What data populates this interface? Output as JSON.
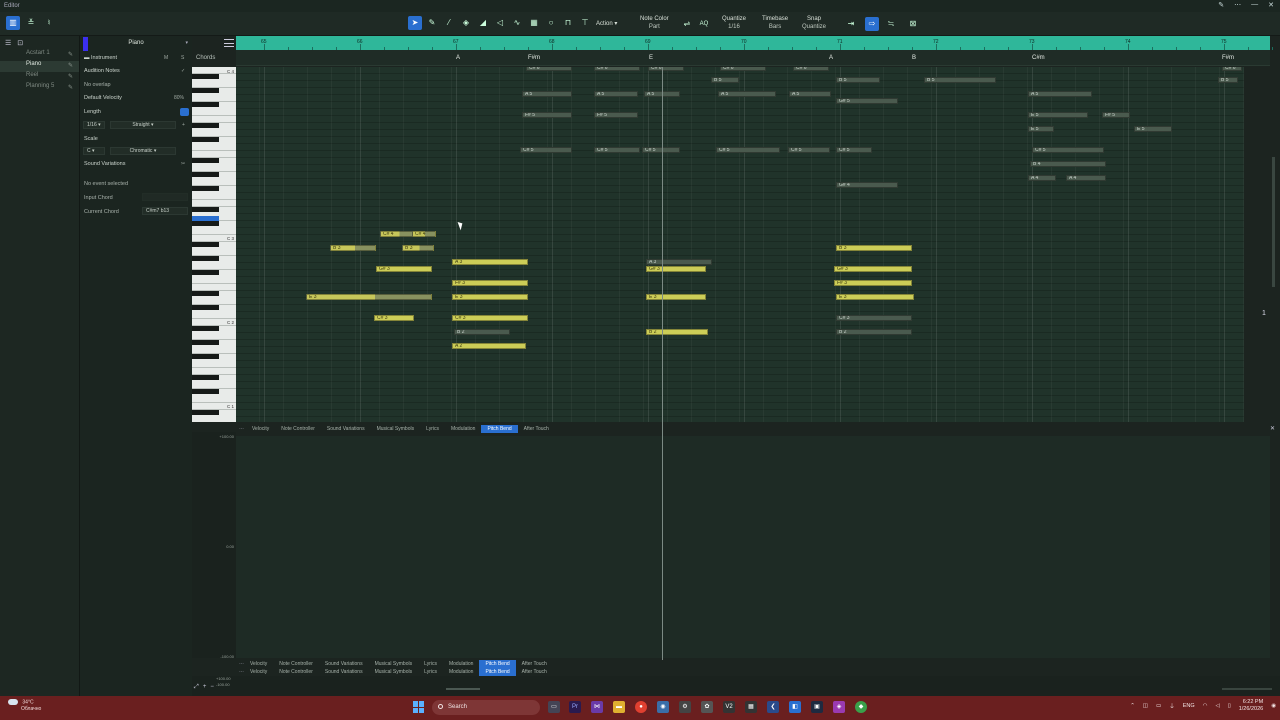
{
  "window": {
    "title": "Editor",
    "controls": [
      "✎",
      "⋯",
      "—",
      "✕"
    ]
  },
  "toolbar": {
    "action_label": "Action",
    "note_color": {
      "title": "Note Color",
      "value": "Part"
    },
    "quantize": {
      "title": "Quantize",
      "value": "1/16"
    },
    "timebase": {
      "title": "Timebase",
      "value": "Bars"
    },
    "snap": {
      "title": "Snap",
      "value": "Quantize"
    }
  },
  "tracks": [
    {
      "label": "Acstart 1",
      "selected": false
    },
    {
      "label": "Piano",
      "selected": true
    },
    {
      "label": "Reel",
      "selected": false
    },
    {
      "label": "Planning 5",
      "selected": false
    }
  ],
  "inspector": {
    "part_name": "Piano",
    "instrument_label": "Instrument",
    "m_label": "M",
    "s_label": "S",
    "audition_notes": "Audition Notes",
    "no_overlap": "No overlap",
    "default_velocity": "Default Velocity",
    "default_velocity_value": "80%",
    "length_label": "Length",
    "length_value": "1/16",
    "length_mode": "Straight",
    "scale_label": "Scale",
    "scale_root": "C",
    "scale_type": "Chromatic",
    "sound_variations": "Sound Variations",
    "no_event": "No event selected",
    "input_chord": "Input Chord",
    "current_chord": "Current Chord",
    "current_chord_value": "C#m7 b13",
    "chords_label": "Chords"
  },
  "ruler": {
    "bars": [
      "65",
      "66",
      "67",
      "68",
      "69",
      "70",
      "71",
      "72",
      "73",
      "74",
      "75"
    ]
  },
  "chord_track": [
    "A",
    "F#m",
    "E",
    "A",
    "B",
    "C#m",
    "F#m"
  ],
  "piano_labels": [
    "C 4",
    "C 3",
    "C 2",
    "C 1"
  ],
  "notes": [
    {
      "label": "C# 6",
      "style": "lo"
    },
    {
      "label": "C# 6",
      "style": "lo"
    },
    {
      "label": "C# 6",
      "style": "lo"
    },
    {
      "label": "C# 6",
      "style": "lo"
    },
    {
      "label": "C# 6",
      "style": "lo"
    },
    {
      "label": "C# 6",
      "style": "lo"
    },
    {
      "label": "B 5",
      "style": "lo"
    },
    {
      "label": "B 5",
      "style": "lo"
    },
    {
      "label": "B 5",
      "style": "lo"
    },
    {
      "label": "B 5",
      "style": "lo"
    },
    {
      "label": "A 5",
      "style": "lo"
    },
    {
      "label": "A 5",
      "style": "lo"
    },
    {
      "label": "A 5",
      "style": "lo"
    },
    {
      "label": "A 5",
      "style": "lo"
    },
    {
      "label": "A 5",
      "style": "lo"
    },
    {
      "label": "A 5",
      "style": "lo"
    },
    {
      "label": "G# 5",
      "style": "lo"
    },
    {
      "label": "F# 5",
      "style": "lo"
    },
    {
      "label": "F# 5",
      "style": "lo"
    },
    {
      "label": "F# 5",
      "style": "lo"
    },
    {
      "label": "E 5",
      "style": "lo"
    },
    {
      "label": "E 5",
      "style": "lo"
    },
    {
      "label": "E 5",
      "style": "lo"
    },
    {
      "label": "C# 5",
      "style": "lo"
    },
    {
      "label": "C# 5",
      "style": "lo"
    },
    {
      "label": "C# 5",
      "style": "lo"
    },
    {
      "label": "C# 5",
      "style": "lo"
    },
    {
      "label": "C# 5",
      "style": "lo"
    },
    {
      "label": "C# 5",
      "style": "lo"
    },
    {
      "label": "C# 5",
      "style": "lo"
    },
    {
      "label": "B 4",
      "style": "lo"
    },
    {
      "label": "A 4",
      "style": "lo"
    },
    {
      "label": "A 4",
      "style": "lo"
    },
    {
      "label": "G# 4",
      "style": "lo"
    },
    {
      "label": "C# 4",
      "style": "mid"
    },
    {
      "label": "C# 4",
      "style": "mid"
    },
    {
      "label": "B 3",
      "style": "mid"
    },
    {
      "label": "B 3",
      "style": "mid"
    },
    {
      "label": "B 3",
      "style": "hi"
    },
    {
      "label": "G# 3",
      "style": "hi"
    },
    {
      "label": "A 3",
      "style": "hi"
    },
    {
      "label": "A 3",
      "style": "lo"
    },
    {
      "label": "G# 3",
      "style": "hi"
    },
    {
      "label": "G# 3",
      "style": "hi"
    },
    {
      "label": "F# 3",
      "style": "hi"
    },
    {
      "label": "F# 3",
      "style": "hi"
    },
    {
      "label": "E 3",
      "style": "mid"
    },
    {
      "label": "E 3",
      "style": "hi"
    },
    {
      "label": "E 3",
      "style": "hi"
    },
    {
      "label": "E 3",
      "style": "hi"
    },
    {
      "label": "C# 3",
      "style": "hi"
    },
    {
      "label": "C# 3",
      "style": "hi"
    },
    {
      "label": "C# 3",
      "style": "lo"
    },
    {
      "label": "B 2",
      "style": "lo"
    },
    {
      "label": "B 2",
      "style": "hi"
    },
    {
      "label": "B 2",
      "style": "lo"
    },
    {
      "label": "A 2",
      "style": "hi"
    }
  ],
  "controller_tabs": [
    "Velocity",
    "Note Controller",
    "Sound Variations",
    "Musical Symbols",
    "Lyrics",
    "Modulation",
    "Pitch Bend",
    "After Touch"
  ],
  "controller_active": "Pitch Bend",
  "lane_values": [
    "+100.00",
    "0.00",
    "-100.00"
  ],
  "lane_values_bottom": [
    "+100.00",
    "-100.00"
  ],
  "taskbar": {
    "weather_temp": "34°C",
    "weather_desc": "Облачно",
    "search_placeholder": "Search",
    "lang": "ENG",
    "time": "6:22 PM",
    "date": "1/26/2026",
    "app_v2": "V2",
    "app_ps": "Pr"
  }
}
